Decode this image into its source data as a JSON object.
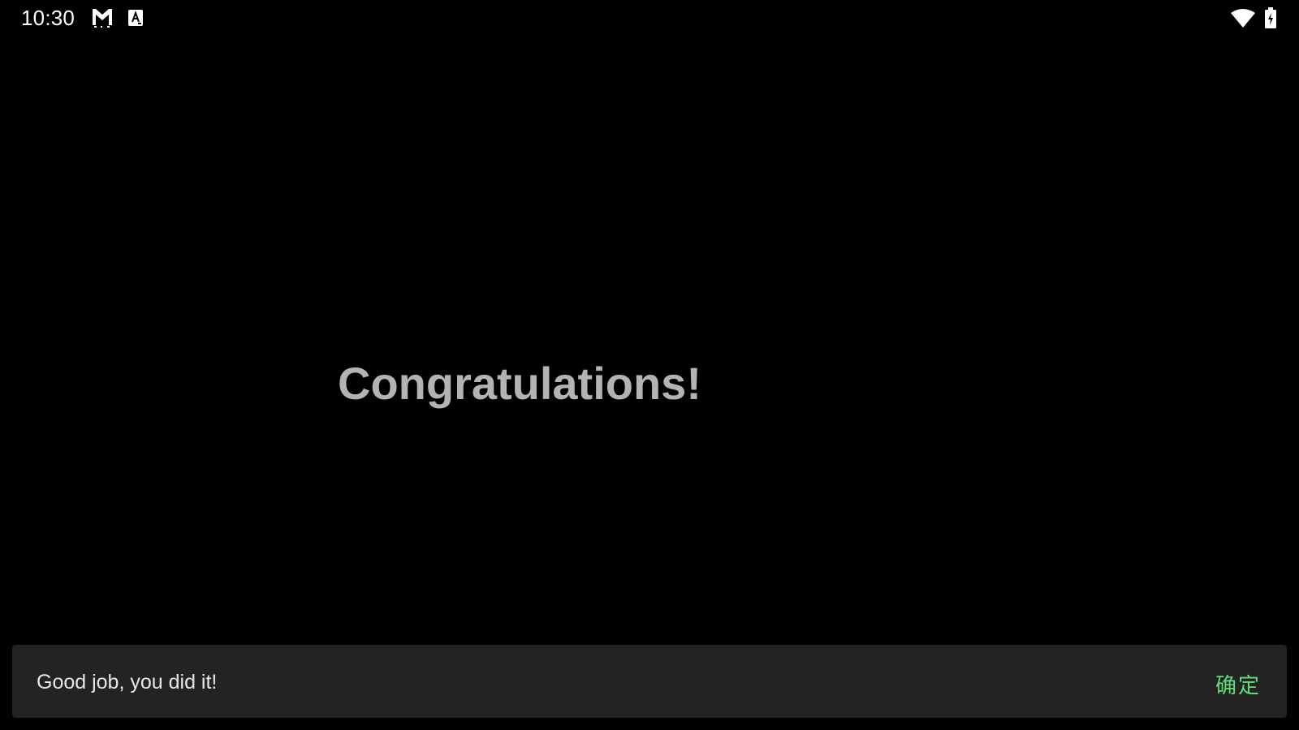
{
  "status_bar": {
    "time": "10:30",
    "icons": [
      "gmail-icon",
      "keyboard-icon",
      "wifi-icon",
      "battery-charging-icon"
    ]
  },
  "main": {
    "headline": "Congratulations!"
  },
  "snackbar": {
    "message": "Good job, you did it!",
    "action_label": "确定",
    "action_color": "#5fe07d"
  },
  "colors": {
    "background": "#000000",
    "headline": "#b3b3b3",
    "snackbar_bg": "#232323"
  }
}
